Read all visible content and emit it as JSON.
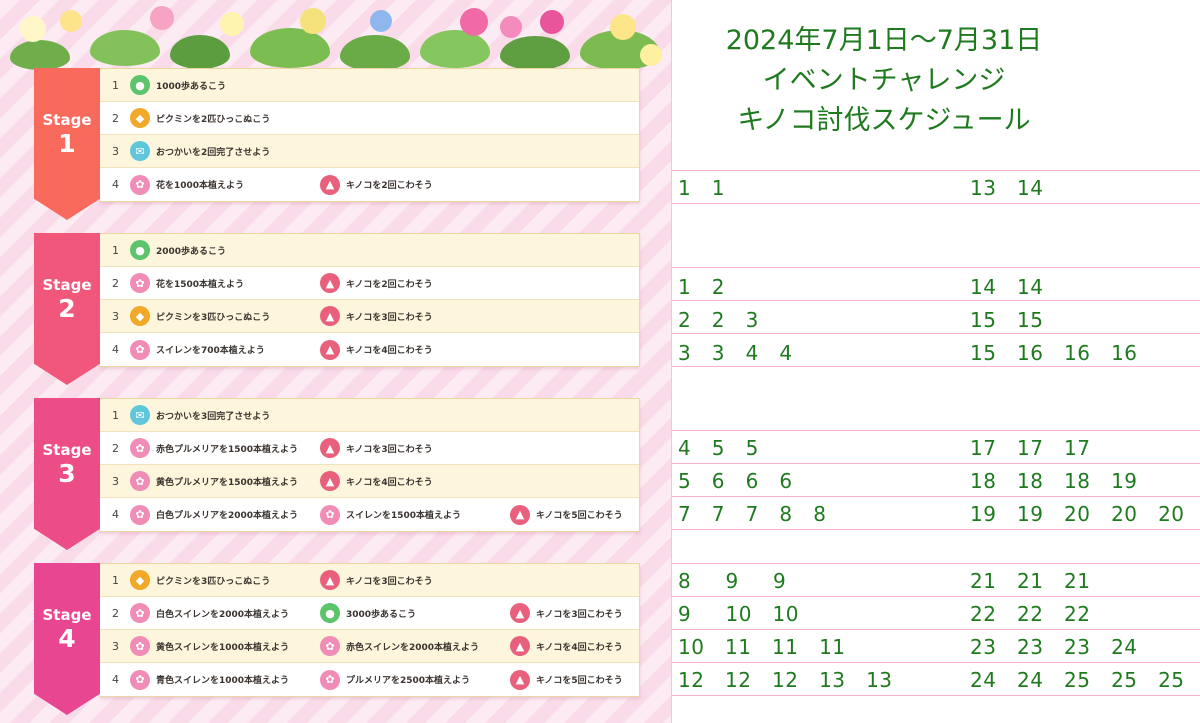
{
  "header": {
    "line1": "2024年7月1日〜7月31日",
    "line2": "イベントチャレンジ",
    "line3": "キノコ討伐スケジュール"
  },
  "stage_word": "Stage",
  "stages": [
    {
      "number": "1",
      "color": "#f76a5c",
      "rows": [
        {
          "num": "1",
          "tasks": [
            {
              "icon": "walk-icon",
              "label": "1000歩あるこう"
            }
          ]
        },
        {
          "num": "2",
          "tasks": [
            {
              "icon": "pikmin-icon",
              "label": "ピクミンを2匹ひっこぬこう"
            }
          ]
        },
        {
          "num": "3",
          "tasks": [
            {
              "icon": "mail-icon",
              "label": "おつかいを2回完了させよう"
            }
          ]
        },
        {
          "num": "4",
          "tasks": [
            {
              "icon": "flower-icon",
              "label": "花を1000本植えよう"
            },
            {
              "icon": "mushroom-icon",
              "label": "キノコを2回こわそう"
            }
          ]
        }
      ]
    },
    {
      "number": "2",
      "color": "#f0577a",
      "rows": [
        {
          "num": "1",
          "tasks": [
            {
              "icon": "walk-icon",
              "label": "2000歩あるこう"
            }
          ]
        },
        {
          "num": "2",
          "tasks": [
            {
              "icon": "flower-icon",
              "label": "花を1500本植えよう"
            },
            {
              "icon": "mushroom-icon",
              "label": "キノコを2回こわそう"
            }
          ]
        },
        {
          "num": "3",
          "tasks": [
            {
              "icon": "pikmin-icon",
              "label": "ピクミンを3匹ひっこぬこう"
            },
            {
              "icon": "mushroom-icon",
              "label": "キノコを3回こわそう"
            }
          ]
        },
        {
          "num": "4",
          "tasks": [
            {
              "icon": "flower-icon",
              "label": "スイレンを700本植えよう"
            },
            {
              "icon": "mushroom-icon",
              "label": "キノコを4回こわそう"
            }
          ]
        }
      ]
    },
    {
      "number": "3",
      "color": "#ec4d86",
      "rows": [
        {
          "num": "1",
          "tasks": [
            {
              "icon": "mail-icon",
              "label": "おつかいを3回完了させよう"
            }
          ]
        },
        {
          "num": "2",
          "tasks": [
            {
              "icon": "flower-icon",
              "label": "赤色プルメリアを1500本植えよう"
            },
            {
              "icon": "mushroom-icon",
              "label": "キノコを3回こわそう"
            }
          ]
        },
        {
          "num": "3",
          "tasks": [
            {
              "icon": "flower-icon",
              "label": "黄色プルメリアを1500本植えよう"
            },
            {
              "icon": "mushroom-icon",
              "label": "キノコを4回こわそう"
            }
          ]
        },
        {
          "num": "4",
          "tasks": [
            {
              "icon": "flower-icon",
              "label": "白色プルメリアを2000本植えよう"
            },
            {
              "icon": "flower-icon",
              "label": "スイレンを1500本植えよう"
            },
            {
              "icon": "mushroom-icon",
              "label": "キノコを5回こわそう"
            }
          ]
        }
      ]
    },
    {
      "number": "4",
      "color": "#e84691",
      "rows": [
        {
          "num": "1",
          "tasks": [
            {
              "icon": "pikmin-icon",
              "label": "ピクミンを3匹ひっこぬこう"
            },
            {
              "icon": "mushroom-icon",
              "label": "キノコを3回こわそう"
            }
          ]
        },
        {
          "num": "2",
          "tasks": [
            {
              "icon": "flower-icon",
              "label": "白色スイレンを2000本植えよう"
            },
            {
              "icon": "walk-icon",
              "label": "3000歩あるこう"
            },
            {
              "icon": "mushroom-icon",
              "label": "キノコを3回こわそう"
            }
          ]
        },
        {
          "num": "3",
          "tasks": [
            {
              "icon": "flower-icon",
              "label": "黄色スイレンを1000本植えよう"
            },
            {
              "icon": "flower-icon",
              "label": "赤色スイレンを2000本植えよう"
            },
            {
              "icon": "mushroom-icon",
              "label": "キノコを4回こわそう"
            }
          ]
        },
        {
          "num": "4",
          "tasks": [
            {
              "icon": "flower-icon",
              "label": "青色スイレンを1000本植えよう"
            },
            {
              "icon": "flower-icon",
              "label": "プルメリアを2500本植えよう"
            },
            {
              "icon": "mushroom-icon",
              "label": "キノコを5回こわそう"
            }
          ]
        }
      ]
    }
  ],
  "schedule": [
    {
      "left": "1   1",
      "right": "13   14"
    },
    {
      "left": "1   2",
      "right": "14   14"
    },
    {
      "left": "2   2   3",
      "right": "15   15"
    },
    {
      "left": "3   3   4   4",
      "right": "15   16   16   16"
    },
    {
      "left": "4   5   5",
      "right": "17   17   17"
    },
    {
      "left": "5   6   6   6",
      "right": "18   18   18   19"
    },
    {
      "left": "7   7   7   8   8",
      "right": "19   19   20   20   20"
    },
    {
      "left": "8     9     9",
      "right": "21   21   21"
    },
    {
      "left": "9     10   10",
      "right": "22   22   22"
    },
    {
      "left": "10   11   11   11",
      "right": "23   23   23   24"
    },
    {
      "left": "12   12   12   13   13",
      "right": "24   24   25   25   25"
    }
  ]
}
